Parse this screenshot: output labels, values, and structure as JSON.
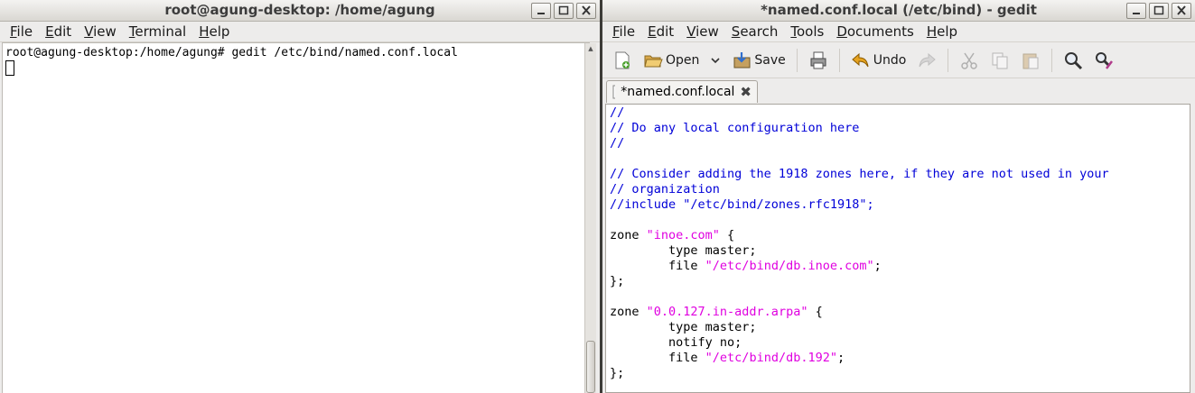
{
  "terminal": {
    "title": "root@agung-desktop: /home/agung",
    "menu": [
      {
        "m": "F",
        "rest": "ile"
      },
      {
        "m": "E",
        "rest": "dit"
      },
      {
        "m": "V",
        "rest": "iew"
      },
      {
        "m": "T",
        "rest": "erminal"
      },
      {
        "m": "H",
        "rest": "elp"
      }
    ],
    "line1": "root@agung-desktop:/home/agung# gedit /etc/bind/named.conf.local"
  },
  "gedit": {
    "title": "*named.conf.local (/etc/bind) - gedit",
    "menu": [
      {
        "m": "F",
        "rest": "ile"
      },
      {
        "m": "E",
        "rest": "dit"
      },
      {
        "m": "V",
        "rest": "iew"
      },
      {
        "m": "S",
        "rest": "earch"
      },
      {
        "m": "T",
        "rest": "ools"
      },
      {
        "m": "D",
        "rest": "ocuments"
      },
      {
        "m": "H",
        "rest": "elp"
      }
    ],
    "toolbar": {
      "open": "Open",
      "save": "Save",
      "undo": "Undo"
    },
    "tab_label": "*named.conf.local",
    "code": [
      [
        {
          "t": "//",
          "c": "cm"
        }
      ],
      [
        {
          "t": "// Do any local configuration here",
          "c": "cm"
        }
      ],
      [
        {
          "t": "//",
          "c": "cm"
        }
      ],
      [],
      [
        {
          "t": "// Consider adding the 1918 zones here, if they are not used in your",
          "c": "cm"
        }
      ],
      [
        {
          "t": "// organization",
          "c": "cm"
        }
      ],
      [
        {
          "t": "//include \"/etc/bind/zones.rfc1918\";",
          "c": "cm"
        }
      ],
      [],
      [
        {
          "t": "zone ",
          "c": ""
        },
        {
          "t": "\"inoe.com\"",
          "c": "str"
        },
        {
          "t": " {",
          "c": ""
        }
      ],
      [
        {
          "t": "        type master;",
          "c": ""
        }
      ],
      [
        {
          "t": "        file ",
          "c": ""
        },
        {
          "t": "\"/etc/bind/db.inoe.com\"",
          "c": "str"
        },
        {
          "t": ";",
          "c": ""
        }
      ],
      [
        {
          "t": "};",
          "c": ""
        }
      ],
      [],
      [
        {
          "t": "zone ",
          "c": ""
        },
        {
          "t": "\"0.0.127.in-addr.arpa\"",
          "c": "str"
        },
        {
          "t": " {",
          "c": ""
        }
      ],
      [
        {
          "t": "        type master;",
          "c": ""
        }
      ],
      [
        {
          "t": "        notify no;",
          "c": ""
        }
      ],
      [
        {
          "t": "        file ",
          "c": ""
        },
        {
          "t": "\"/etc/bind/db.192\"",
          "c": "str"
        },
        {
          "t": ";",
          "c": ""
        }
      ],
      [
        {
          "t": "};",
          "c": ""
        }
      ]
    ]
  }
}
